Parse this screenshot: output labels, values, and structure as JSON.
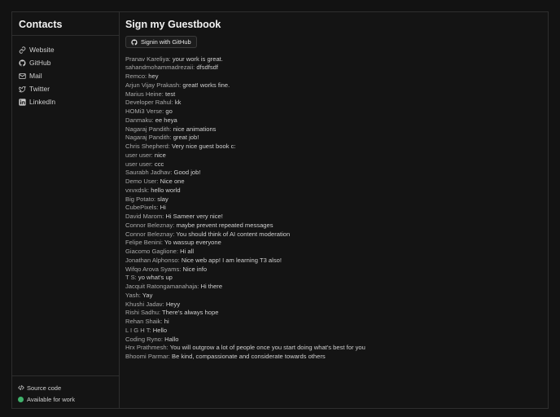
{
  "sidebar": {
    "title": "Contacts",
    "items": [
      {
        "label": "Website",
        "icon": "link-icon"
      },
      {
        "label": "GitHub",
        "icon": "github-icon"
      },
      {
        "label": "Mail",
        "icon": "mail-icon"
      },
      {
        "label": "Twitter",
        "icon": "twitter-icon"
      },
      {
        "label": "LinkedIn",
        "icon": "linkedin-icon"
      }
    ],
    "footer": {
      "source_label": "Source code",
      "status_label": "Available for work",
      "status_color": "#3fb26b"
    }
  },
  "main": {
    "title": "Sign my Guestbook",
    "signin_label": "Signin with GitHub",
    "entries": [
      {
        "author": "Pranav Kareliya:",
        "message": "your work is great."
      },
      {
        "author": "sahandmohammadrezaii:",
        "message": "dfsdfsdf"
      },
      {
        "author": "Remco:",
        "message": "hey"
      },
      {
        "author": "Arjun Vijay Prakash:",
        "message": "great! works fine."
      },
      {
        "author": "Marius Heine:",
        "message": "test"
      },
      {
        "author": "Developer Rahul:",
        "message": "kk"
      },
      {
        "author": "HOMi3 Verse:",
        "message": "go"
      },
      {
        "author": "Danmaku:",
        "message": "ee heya"
      },
      {
        "author": "Nagaraj Pandith:",
        "message": "nice animations"
      },
      {
        "author": "Nagaraj Pandith:",
        "message": "great job!"
      },
      {
        "author": "Chris Shepherd:",
        "message": "Very nice guest book c:"
      },
      {
        "author": "user user:",
        "message": "nice"
      },
      {
        "author": "user user:",
        "message": "ccc"
      },
      {
        "author": "Saurabh Jadhav:",
        "message": "Good job!"
      },
      {
        "author": "Demo User:",
        "message": "Nice one"
      },
      {
        "author": "vxvxdsk:",
        "message": "hello world"
      },
      {
        "author": "Big Potato:",
        "message": "slay"
      },
      {
        "author": "CubePixels:",
        "message": "Hi"
      },
      {
        "author": "David Marom:",
        "message": "Hi Sameer very nice!"
      },
      {
        "author": "Connor Beleznay:",
        "message": "maybe prevent repeated messages"
      },
      {
        "author": "Connor Beleznay:",
        "message": "You should think of AI content moderation"
      },
      {
        "author": "Felipe Benini:",
        "message": "Yo wassup everyone"
      },
      {
        "author": "Giacomo Gaglione:",
        "message": "Hi all"
      },
      {
        "author": "Jonathan Alphonso:",
        "message": "Nice web app! I am learning T3 also!"
      },
      {
        "author": "Wifqo Arova Syams:",
        "message": "Nice info"
      },
      {
        "author": "T S:",
        "message": "yo what's up"
      },
      {
        "author": "Jacquit Ratongamanahaja:",
        "message": "Hi there"
      },
      {
        "author": "Yash:",
        "message": "Yay"
      },
      {
        "author": "Khushi Jadav:",
        "message": "Heyy"
      },
      {
        "author": "Rishi Sadhu:",
        "message": "There's always hope"
      },
      {
        "author": "Rehan Shaik:",
        "message": "hi"
      },
      {
        "author": "L I G H T:",
        "message": "Hello"
      },
      {
        "author": "Coding Ryno:",
        "message": "Hallo"
      },
      {
        "author": "Hrx Prathmesh:",
        "message": "You will outgrow a lot of people once you start doing what's best for you"
      },
      {
        "author": "Bhoomi Parmar:",
        "message": "Be kind, compassionate and considerate towards others"
      }
    ]
  }
}
